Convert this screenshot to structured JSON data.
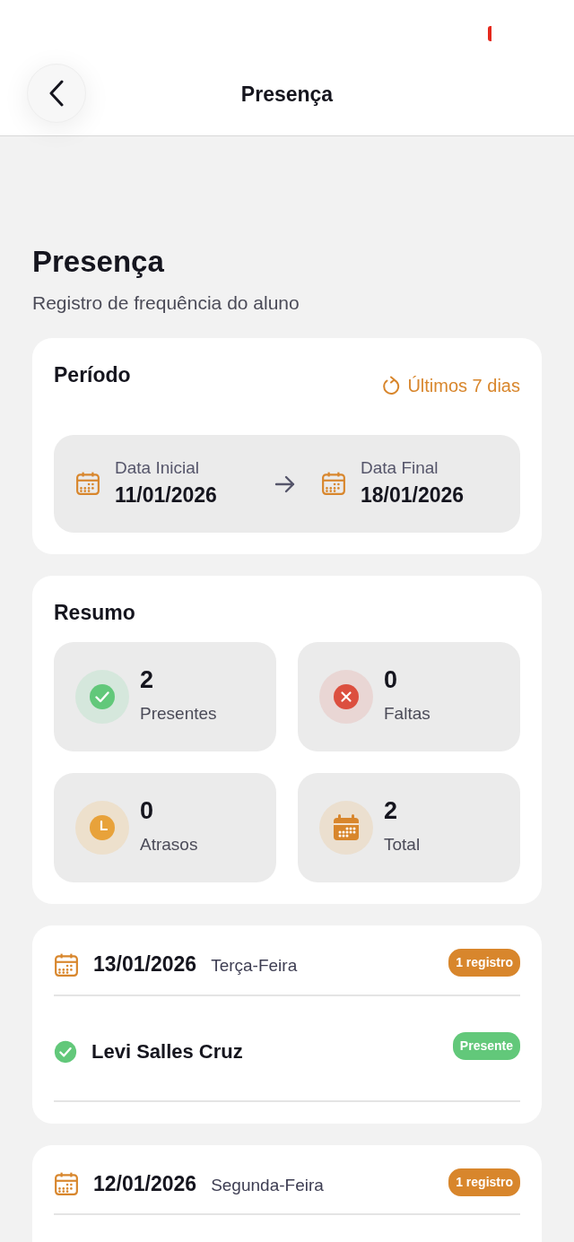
{
  "header": {
    "title": "Presença"
  },
  "page": {
    "title": "Presença",
    "subtitle": "Registro de frequência do aluno"
  },
  "period": {
    "title": "Período",
    "preset": "Últimos 7 dias",
    "start_label": "Data Inicial",
    "start_date": "11/01/2026",
    "end_label": "Data Final",
    "end_date": "18/01/2026"
  },
  "summary": {
    "title": "Resumo",
    "stats": [
      {
        "kind": "present",
        "value": "2",
        "label": "Presentes"
      },
      {
        "kind": "absent",
        "value": "0",
        "label": "Faltas"
      },
      {
        "kind": "late",
        "value": "0",
        "label": "Atrasos"
      },
      {
        "kind": "total",
        "value": "2",
        "label": "Total"
      }
    ]
  },
  "days": [
    {
      "date": "13/01/2026",
      "weekday": "Terça-Feira",
      "count": "1 registro",
      "records": [
        {
          "kind": "present",
          "name": "Levi Salles Cruz",
          "status": "Presente"
        }
      ]
    },
    {
      "date": "12/01/2026",
      "weekday": "Segunda-Feira",
      "count": "1 registro"
    }
  ]
}
